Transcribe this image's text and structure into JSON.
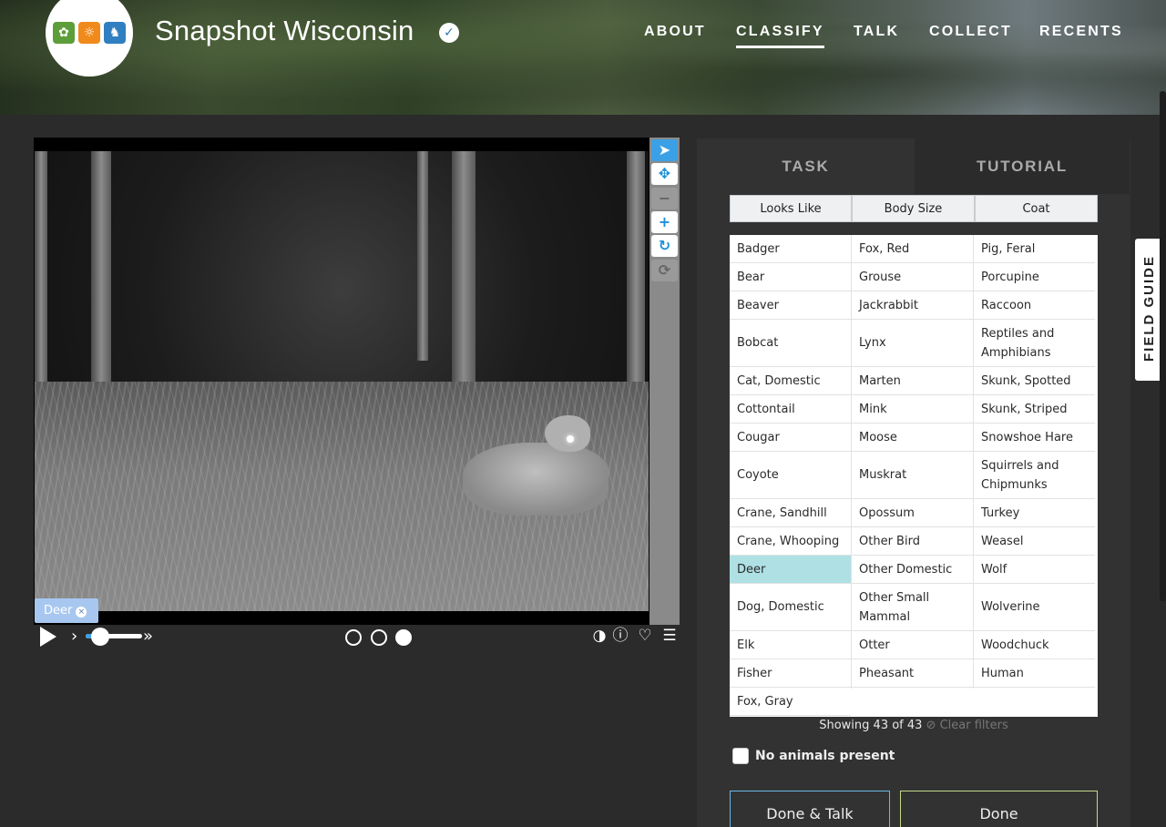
{
  "header": {
    "brand": "Snapshot Wisconsin",
    "nav": [
      "ABOUT",
      "CLASSIFY",
      "TALK",
      "COLLECT",
      "RECENTS"
    ],
    "active_nav": "CLASSIFY"
  },
  "viewer": {
    "tag_label": "Deer",
    "frames": 3,
    "current_frame": 3
  },
  "task": {
    "tabs": [
      "TASK",
      "TUTORIAL"
    ],
    "filters": [
      "Looks Like",
      "Body Size",
      "Coat"
    ],
    "columns": [
      [
        "Badger",
        "Bear",
        "Beaver",
        "Bobcat",
        "Cat, Domestic",
        "Cottontail",
        "Cougar",
        "Coyote",
        "Crane, Sandhill",
        "Crane, Whooping",
        "Deer",
        "Dog, Domestic",
        "Elk",
        "Fisher",
        "Fox, Gray"
      ],
      [
        "Fox, Red",
        "Grouse",
        "Jackrabbit",
        "Lynx",
        "Marten",
        "Mink",
        "Moose",
        "Muskrat",
        "Opossum",
        "Other Bird",
        "Other Domestic",
        "Other Small Mammal",
        "Otter",
        "Pheasant"
      ],
      [
        "Pig, Feral",
        "Porcupine",
        "Raccoon",
        "Reptiles and Amphibians",
        "Skunk, Spotted",
        "Skunk, Striped",
        "Snowshoe Hare",
        "Squirrels and Chipmunks",
        "Turkey",
        "Weasel",
        "Wolf",
        "Wolverine",
        "Woodchuck",
        "Human"
      ]
    ],
    "selected": "Deer",
    "showing": "Showing 43 of 43",
    "clear_filters": "Clear filters",
    "no_animals": "No animals present",
    "done_talk": "Done & Talk",
    "done": "Done"
  },
  "field_guide": "FIELD GUIDE",
  "colors": {
    "accent": "#3ba0e5",
    "selected_choice": "#aee0e4",
    "done_border": "#c4d98a",
    "talk_border": "#6bb8e5"
  }
}
